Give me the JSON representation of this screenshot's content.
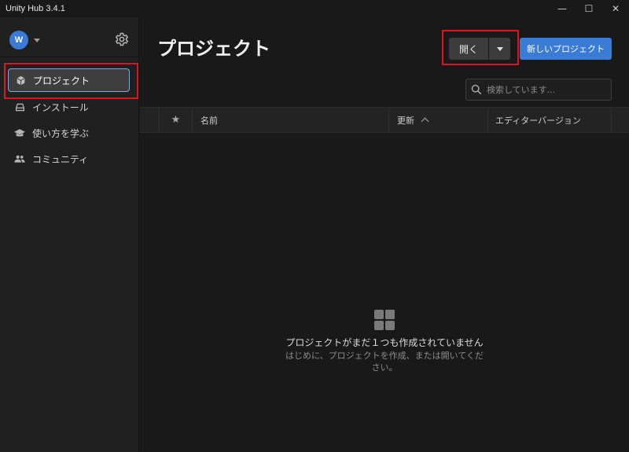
{
  "window": {
    "title": "Unity Hub 3.4.1",
    "minimize_glyph": "—",
    "maximize_glyph": "☐",
    "close_glyph": "✕"
  },
  "account": {
    "avatar_initial": "W"
  },
  "sidebar": {
    "items": [
      {
        "label": "プロジェクト",
        "icon": "cube-icon",
        "active": true
      },
      {
        "label": "インストール",
        "icon": "drive-icon",
        "active": false
      },
      {
        "label": "使い方を学ぶ",
        "icon": "graduation-cap-icon",
        "active": false
      },
      {
        "label": "コミュニティ",
        "icon": "people-icon",
        "active": false
      }
    ]
  },
  "main": {
    "title": "プロジェクト",
    "open_label": "開く",
    "new_project_label": "新しいプロジェクト",
    "search_placeholder": "検索しています..."
  },
  "table": {
    "star_glyph": "★",
    "columns": {
      "name": "名前",
      "modified": "更新",
      "editor_version": "エディターバージョン"
    }
  },
  "empty_state": {
    "title": "プロジェクトがまだ１つも作成されていません",
    "subtitle": "はじめに、プロジェクトを作成、または開いてくだ\nさい。"
  },
  "colors": {
    "accent": "#3a7bd5",
    "highlight_box": "#e0141e",
    "background": "#191919",
    "sidebar": "#202020"
  }
}
